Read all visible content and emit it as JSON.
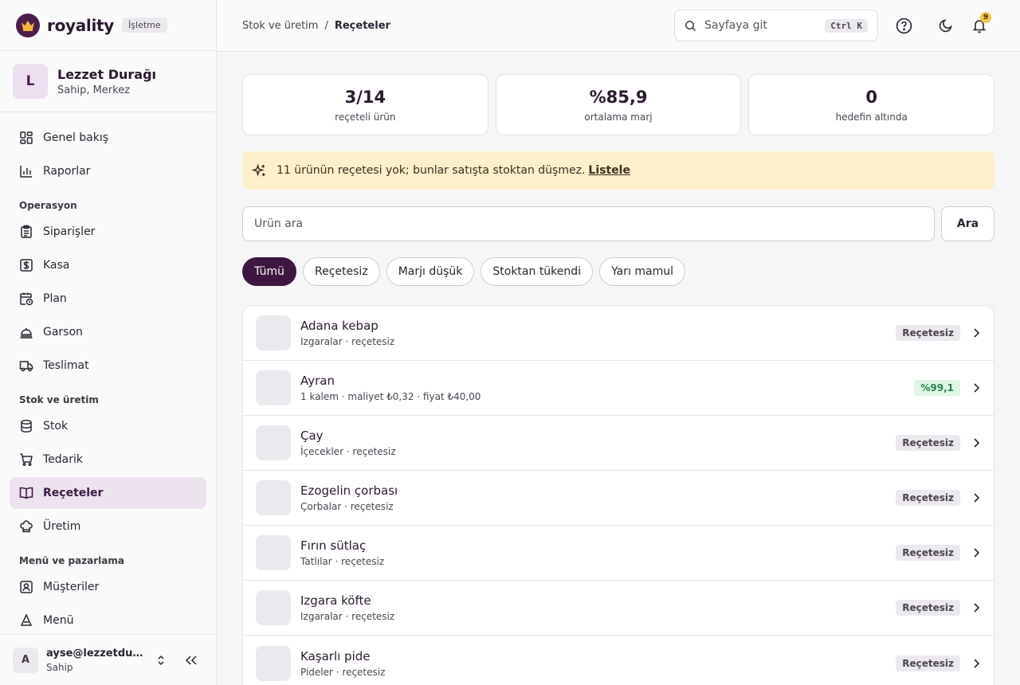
{
  "brand": {
    "name": "royality",
    "badge": "İşletme"
  },
  "org": {
    "initial": "L",
    "name": "Lezzet Durağı",
    "role": "Sahip, Merkez"
  },
  "nav": {
    "top": [
      {
        "label": "Genel bakış",
        "icon": "dashboard-icon"
      },
      {
        "label": "Raporlar",
        "icon": "bar-chart-icon"
      }
    ],
    "sections": [
      {
        "title": "Operasyon",
        "items": [
          {
            "label": "Siparişler",
            "icon": "clipboard-icon"
          },
          {
            "label": "Kasa",
            "icon": "cash-register-icon"
          },
          {
            "label": "Plan",
            "icon": "calendar-clock-icon"
          },
          {
            "label": "Garson",
            "icon": "cloche-icon"
          },
          {
            "label": "Teslimat",
            "icon": "truck-icon"
          }
        ]
      },
      {
        "title": "Stok ve üretim",
        "items": [
          {
            "label": "Stok",
            "icon": "database-icon"
          },
          {
            "label": "Tedarik",
            "icon": "cart-icon"
          },
          {
            "label": "Reçeteler",
            "icon": "book-open-icon",
            "active": true
          },
          {
            "label": "Üretim",
            "icon": "chef-hat-icon"
          }
        ]
      },
      {
        "title": "Menü ve pazarlama",
        "items": [
          {
            "label": "Müşteriler",
            "icon": "contact-icon"
          },
          {
            "label": "Menü",
            "icon": "menu-book-icon"
          }
        ]
      }
    ]
  },
  "user": {
    "initial": "A",
    "email": "ayse@lezzetduragi.com",
    "role": "Sahip"
  },
  "topbar": {
    "breadcrumb": [
      "Stok ve üretim",
      "Reçeteler"
    ],
    "search_placeholder": "Sayfaya git",
    "shortcut": "Ctrl K",
    "notification_count": "9"
  },
  "stats": [
    {
      "value": "3/14",
      "label": "reçeteli ürün"
    },
    {
      "value": "%85,9",
      "label": "ortalama marj"
    },
    {
      "value": "0",
      "label": "hedefin altında"
    }
  ],
  "alert": {
    "text": "11 ürünün reçetesi yok; bunlar satışta stoktan düşmez.",
    "link": "Listele"
  },
  "search": {
    "placeholder": "Ürün ara",
    "button": "Ara"
  },
  "filters": [
    {
      "label": "Tümü",
      "active": true
    },
    {
      "label": "Reçetesiz"
    },
    {
      "label": "Marjı düşük"
    },
    {
      "label": "Stoktan tükendi"
    },
    {
      "label": "Yarı mamul"
    }
  ],
  "products": [
    {
      "name": "Adana kebap",
      "sub": "Izgaralar · reçetesiz",
      "badge": "Reçetesiz",
      "status": "none"
    },
    {
      "name": "Ayran",
      "sub": "1 kalem · maliyet ₺0,32 · fiyat ₺40,00",
      "badge": "%99,1",
      "status": "good"
    },
    {
      "name": "Çay",
      "sub": "İçecekler · reçetesiz",
      "badge": "Reçetesiz",
      "status": "none"
    },
    {
      "name": "Ezogelin çorbası",
      "sub": "Çorbalar · reçetesiz",
      "badge": "Reçetesiz",
      "status": "none"
    },
    {
      "name": "Fırın sütlaç",
      "sub": "Tatlılar · reçetesiz",
      "badge": "Reçetesiz",
      "status": "none"
    },
    {
      "name": "Izgara köfte",
      "sub": "Izgaralar · reçetesiz",
      "badge": "Reçetesiz",
      "status": "none"
    },
    {
      "name": "Kaşarlı pide",
      "sub": "Pideler · reçetesiz",
      "badge": "Reçetesiz",
      "status": "none"
    }
  ],
  "colors": {
    "accent": "#3e1741",
    "active_bg": "#ede3ef",
    "alert_bg": "#fcefc9",
    "good": "#23804a"
  }
}
